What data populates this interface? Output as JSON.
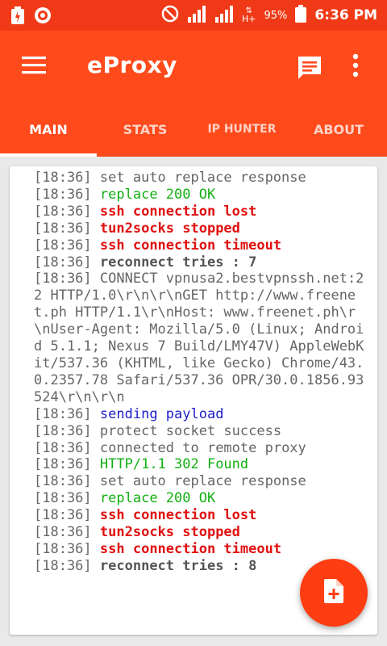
{
  "status_bar": {
    "battery_percent": "95%",
    "time": "6:36 PM",
    "icons": [
      "charging-icon",
      "app-notification-icon",
      "do-not-disturb-icon",
      "signal-icon",
      "signal-icon-2",
      "data-hplus-icon",
      "battery-icon"
    ],
    "network_label": "H+"
  },
  "app_bar": {
    "title": "eProxy",
    "icons": [
      "menu-icon",
      "chat-icon",
      "more-vert-icon"
    ]
  },
  "tabs": [
    {
      "label": "MAIN",
      "active": true
    },
    {
      "label": "STATS",
      "active": false
    },
    {
      "label": "IP HUNTER",
      "active": false
    },
    {
      "label": "ABOUT",
      "active": false
    }
  ],
  "log": {
    "cut_line": "[18:36] set auto replace response",
    "lines": [
      {
        "time": "[18:36]",
        "msg": "replace 200 OK",
        "style": "green"
      },
      {
        "time": "[18:36]",
        "msg": "ssh connection lost",
        "style": "red"
      },
      {
        "time": "[18:36]",
        "msg": "tun2socks stopped",
        "style": "red"
      },
      {
        "time": "[18:36]",
        "msg": "ssh connection timeout",
        "style": "red"
      },
      {
        "time": "[18:36]",
        "msg": "reconnect tries : 7",
        "style": "darkgray"
      },
      {
        "time": "[18:36]",
        "msg": "CONNECT vpnusa2.bestvpnssh.net:22 HTTP/1.0\\r\\n\\r\\nGET http://www.freenet.ph HTTP/1.1\\r\\nHost: www.freenet.ph\\r\\nUser-Agent: Mozilla/5.0 (Linux; Android 5.1.1; Nexus 7 Build/LMY47V) AppleWebKit/537.36 (KHTML, like Gecko) Chrome/43.0.2357.78 Safari/537.36 OPR/30.0.1856.93524\\r\\n\\r\\n",
        "style": "gray"
      },
      {
        "time": "[18:36]",
        "msg": "sending payload",
        "style": "blue"
      },
      {
        "time": "[18:36]",
        "msg": "protect socket success",
        "style": "gray"
      },
      {
        "time": "[18:36]",
        "msg": "connected to remote proxy",
        "style": "gray"
      },
      {
        "time": "[18:36]",
        "msg": "HTTP/1.1 302 Found",
        "style": "green"
      },
      {
        "time": "[18:36]",
        "msg": "set auto replace response",
        "style": "gray"
      },
      {
        "time": "[18:36]",
        "msg": "replace 200 OK",
        "style": "green"
      },
      {
        "time": "[18:36]",
        "msg": "ssh connection lost",
        "style": "red"
      },
      {
        "time": "[18:36]",
        "msg": "tun2socks stopped",
        "style": "red"
      },
      {
        "time": "[18:36]",
        "msg": "ssh connection timeout",
        "style": "red"
      },
      {
        "time": "[18:36]",
        "msg": "reconnect tries : 8",
        "style": "darkgray"
      }
    ]
  },
  "fab": {
    "icon": "add-file-icon"
  },
  "colors": {
    "status_bar": "#f03a17",
    "app_bar": "#ff4a1c",
    "fab": "#ff3d12",
    "log_green": "#12b012",
    "log_red": "#e01010",
    "log_blue": "#1d1dcc",
    "log_gray": "#666666"
  }
}
